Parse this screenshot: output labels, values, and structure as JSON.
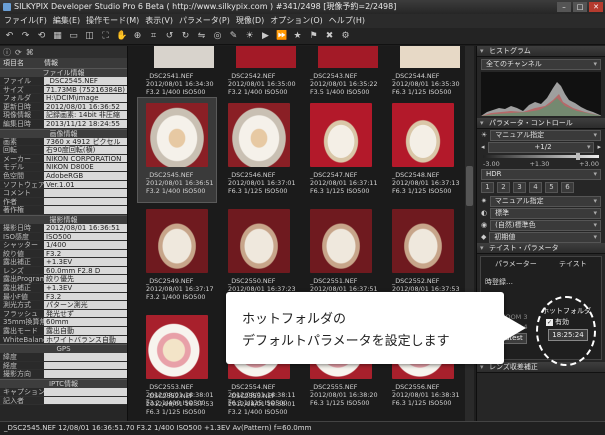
{
  "window": {
    "title": "SILKYPIX Developer Studio Pro 6 Beta ( http://www.silkypix.com )   #341/2498 [現像予約=2/2498]"
  },
  "menu": [
    "ファイル(F)",
    "編集(E)",
    "操作モード(M)",
    "表示(V)",
    "パラメータ(P)",
    "現像(D)",
    "オプション(O)",
    "ヘルプ(H)"
  ],
  "left_panel": {
    "col_key": "項目名",
    "col_val": "情報",
    "sections": [
      {
        "title": "ファイル情報",
        "rows": [
          [
            "ファイル",
            "_DSC2545.NEF"
          ],
          [
            "サイズ",
            "71.73MB (75216384B)"
          ],
          [
            "フォルダ",
            "H:\\DCIM\\image"
          ],
          [
            "更新日時",
            "2012/08/01 16:36:52"
          ],
          [
            "現像情報",
            "記録画素: 14bit 非圧縮"
          ],
          [
            "編集日時",
            "2013/11/12 18:24:55"
          ]
        ]
      },
      {
        "title": "画像情報",
        "rows": [
          [
            "画素",
            "7360 x 4912 ピクセル"
          ],
          [
            "回転",
            "右90度回転(横)"
          ],
          [
            "メーカー",
            "NIKON CORPORATION"
          ],
          [
            "モデル",
            "NIKON D800E"
          ],
          [
            "色空間",
            "AdobeRGB"
          ],
          [
            "ソフトウェア",
            "Ver.1.01"
          ],
          [
            "コメント",
            ""
          ],
          [
            "作者",
            ""
          ],
          [
            "著作権",
            ""
          ]
        ]
      },
      {
        "title": "撮影情報",
        "rows": [
          [
            "撮影日時",
            "2012/08/01 16:36:51"
          ],
          [
            "ISO感度",
            "ISO500"
          ],
          [
            "シャッター",
            "1/400"
          ],
          [
            "絞り値",
            "F3.2"
          ],
          [
            "露出補正",
            "+1.3EV"
          ],
          [
            "レンズ",
            "60.0mm F2.8 D"
          ],
          [
            "露出Program",
            "絞り優先"
          ],
          [
            "露出補正",
            "+1.3EV"
          ],
          [
            "最小F値",
            "F3.2"
          ],
          [
            "測光方式",
            "パターン測光"
          ],
          [
            "フラッシュ",
            "発光せず"
          ],
          [
            "35mm換算焦点距離",
            "60mm"
          ],
          [
            "露出モード",
            "露出自動"
          ],
          [
            "WhiteBalance",
            "ホワイトバランス自動"
          ]
        ]
      },
      {
        "title": "GPS",
        "rows": [
          [
            "緯度",
            ""
          ],
          [
            "経度",
            ""
          ],
          [
            "撮影方向",
            ""
          ]
        ]
      },
      {
        "title": "IPTC情報",
        "rows": [
          [
            "キャプション",
            ""
          ],
          [
            "記入者",
            ""
          ]
        ]
      }
    ]
  },
  "thumbnails": {
    "top_row": [
      {
        "file": "_DSC2541.NEF",
        "date": "2012/08/01 16:34:30",
        "exp": "F3.2  1/400   ISO500"
      },
      {
        "file": "_DSC2542.NEF",
        "date": "2012/08/01 16:35:00",
        "exp": "F3.2  1/400   ISO500"
      },
      {
        "file": "_DSC2543.NEF",
        "date": "2012/08/01 16:35:22",
        "exp": "F3.5  1/400   ISO500"
      },
      {
        "file": "_DSC2544.NEF",
        "date": "2012/08/01 16:35:30",
        "exp": "F6.3  1/125   ISO500"
      }
    ],
    "rows": [
      [
        {
          "file": "_DSC2545.NEF",
          "date": "2012/08/01 16:36:51",
          "exp": "F3.2  1/400   ISO500",
          "style": "w",
          "selected": true
        },
        {
          "file": "_DSC2546.NEF",
          "date": "2012/08/01 16:37:01",
          "exp": "F6.3  1/125   ISO500",
          "style": "w"
        },
        {
          "file": "_DSC2547.NEF",
          "date": "2012/08/01 16:37:11",
          "exp": "F6.3  1/125   ISO500",
          "style": "r"
        },
        {
          "file": "_DSC2548.NEF",
          "date": "2012/08/01 16:37:13",
          "exp": "F6.3  1/125   ISO500",
          "style": "r"
        }
      ],
      [
        {
          "file": "_DSC2549.NEF",
          "date": "2012/08/01 16:37:17",
          "exp": "F3.2  1/400   ISO500",
          "style": "dk"
        },
        {
          "file": "_DSC2550.NEF",
          "date": "2012/08/01 16:37:23",
          "exp": "F3.2  1/400   ISO500",
          "style": "dk"
        },
        {
          "file": "_DSC2551.NEF",
          "date": "2012/08/01 16:37:51",
          "exp": "F6.3  1/125   ISO500",
          "style": "dk"
        },
        {
          "file": "_DSC2552.NEF",
          "date": "2012/08/01 16:37:53",
          "exp": "F6.3  1/125   ISO500",
          "style": "dk"
        }
      ],
      [
        {
          "file": "_DSC2553.NEF",
          "date": "2012/08/01 16:38:01",
          "exp": "F3.2  1/400   ISO500",
          "style": "p"
        },
        {
          "file": "_DSC2554.NEF",
          "date": "2012/08/01 16:38:11",
          "exp": "F6.3  1/125   ISO500",
          "style": "p"
        },
        {
          "file": "_DSC2555.NEF",
          "date": "2012/08/01 16:38:20",
          "exp": "F6.3  1/125   ISO500",
          "style": "p"
        },
        {
          "file": "_DSC2556.NEF",
          "date": "2012/08/01 16:38:31",
          "exp": "F6.3  1/125   ISO500",
          "style": "p"
        }
      ]
    ],
    "bottom_labels": [
      {
        "file": "_DSC2552.NEF",
        "date": "2012/08/01 16:37:53",
        "exp": "F6.3  1/125   ISO500"
      },
      {
        "file": "_DSC2553.NEF",
        "date": "2012/08/01 16:38:01",
        "exp": "F3.2  1/400   ISO500"
      },
      {
        "file": "_DSC2554.NEF",
        "date": "2012/08/01 16:38:11",
        "exp": "F6.3  1/125   ISO500"
      },
      {
        "file": "_DSC2555.NEF",
        "date": "2012/08/01 16:38:20",
        "exp": "F6.3  1/125   ISO500"
      }
    ]
  },
  "right_panel": {
    "histogram_title": "ヒストグラム",
    "channel": "全てのチャンネル",
    "param_title": "パラメータ・コントロール",
    "exposure_mode": "マニュアル指定",
    "exposure_value": "+1/2",
    "scale_min": "-3.00",
    "scale_val": "+1.30",
    "scale_max": "+3.00",
    "hdr_label": "HDR",
    "wb_mode": "マニュアル指定",
    "tone": "標準",
    "color": "(自然)標準色",
    "sharp": "初期値",
    "taste_title": "テイスト・パラメータ",
    "param_tab": "パラメーター",
    "taste_tab": "テイスト",
    "history_label": "時登録…",
    "zoom_items": [
      "ZOOM 3",
      "ZOOM 4"
    ],
    "latest_btn": "Latest",
    "lens_title": "レンズ収差補正"
  },
  "hot_folder": {
    "title": "ホットフォルダ",
    "enable_label": "有効",
    "time": "18:25:24"
  },
  "callout": {
    "line1": "ホットフォルダの",
    "line2": "デフォルトパラメータを設定します"
  },
  "status": "_DSC2545.NEF 12/08/01 16:36:51.70 F3.2  1/400   ISO500 +1.3EV Av(Pattern) f=60.0mm"
}
